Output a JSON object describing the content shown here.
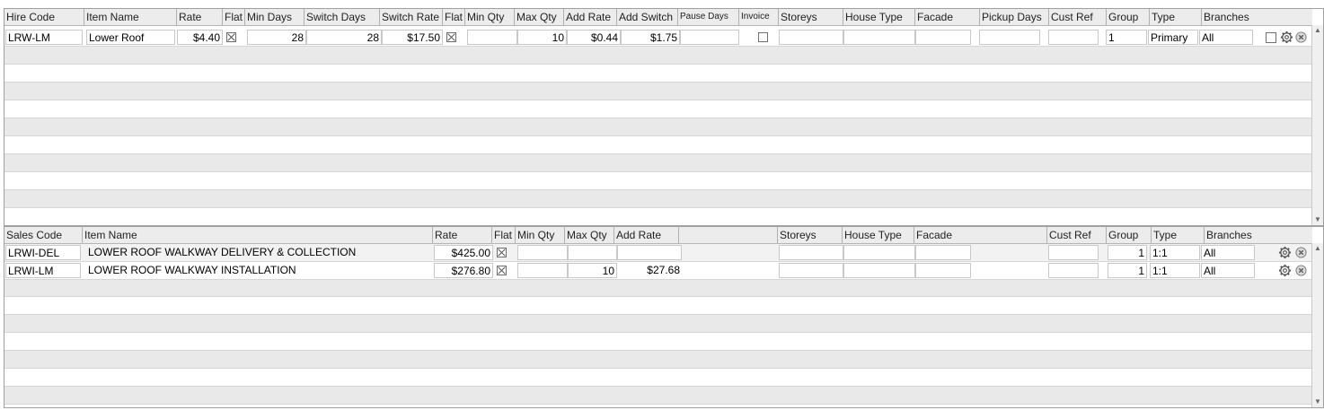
{
  "hire": {
    "headers": {
      "hire_code": "Hire Code",
      "item_name": "Item Name",
      "rate": "Rate",
      "flat": "Flat",
      "min_days": "Min Days",
      "switch_days": "Switch Days",
      "switch_rate": "Switch Rate",
      "flat2": "Flat",
      "min_qty": "Min Qty",
      "max_qty": "Max Qty",
      "add_rate": "Add Rate",
      "add_switch": "Add Switch",
      "pause_days": "Pause Days",
      "invoice": "Invoice",
      "storeys": "Storeys",
      "house_type": "House Type",
      "facade": "Facade",
      "pickup_days": "Pickup Days",
      "cust_ref": "Cust Ref",
      "group": "Group",
      "type": "Type",
      "branches": "Branches"
    },
    "rows": [
      {
        "hire_code": "LRW-LM",
        "item_name": "Lower Roof",
        "rate": "$4.40",
        "flat": true,
        "min_days": "28",
        "switch_days": "28",
        "switch_rate": "$17.50",
        "flat2": true,
        "min_qty": "",
        "max_qty": "10",
        "add_rate": "$0.44",
        "add_switch": "$1.75",
        "pause_days": "",
        "invoice": false,
        "storeys": "",
        "house_type": "",
        "facade": "",
        "pickup_days": "",
        "cust_ref": "",
        "group": "1",
        "type": "Primary",
        "branches": "All",
        "select": false
      }
    ]
  },
  "sales": {
    "headers": {
      "sales_code": "Sales Code",
      "item_name": "Item Name",
      "rate": "Rate",
      "flat": "Flat",
      "min_qty": "Min Qty",
      "max_qty": "Max Qty",
      "add_rate": "Add Rate",
      "storeys": "Storeys",
      "house_type": "House Type",
      "facade": "Facade",
      "cust_ref": "Cust Ref",
      "group": "Group",
      "type": "Type",
      "branches": "Branches"
    },
    "rows": [
      {
        "sales_code": "LRWI-DEL",
        "item_name": "LOWER ROOF WALKWAY DELIVERY & COLLECTION",
        "rate": "$425.00",
        "flat": true,
        "min_qty": "",
        "max_qty": "",
        "add_rate": "",
        "storeys": "",
        "house_type": "",
        "facade": "",
        "cust_ref": "",
        "group": "1",
        "type": "1:1",
        "branches": "All"
      },
      {
        "sales_code": "LRWI-LM",
        "item_name": "LOWER ROOF WALKWAY INSTALLATION",
        "rate": "$276.80",
        "flat": true,
        "min_qty": "",
        "max_qty": "10",
        "add_rate": "$27.68",
        "storeys": "",
        "house_type": "",
        "facade": "",
        "cust_ref": "",
        "group": "1",
        "type": "1:1",
        "branches": "All"
      }
    ]
  },
  "icons": {
    "settings": "gear-icon",
    "remove": "close-circle-icon",
    "scroll_up": "arrow-up-icon",
    "scroll_down": "arrow-down-icon"
  }
}
